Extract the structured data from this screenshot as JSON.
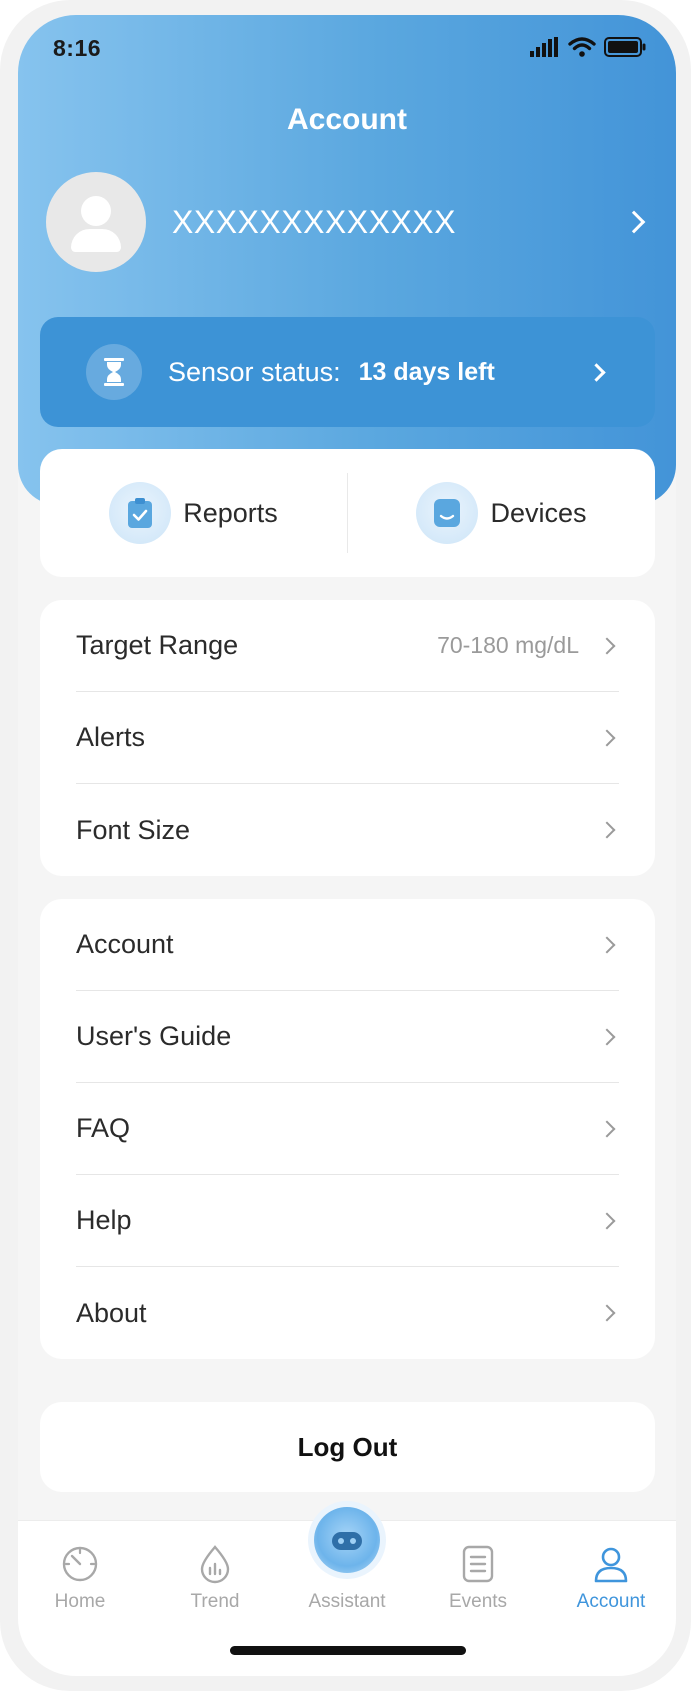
{
  "status_bar": {
    "time": "8:16"
  },
  "header": {
    "title": "Account"
  },
  "profile": {
    "name": "XXXXXXXXXXXXX"
  },
  "sensor": {
    "label": "Sensor status:",
    "value": "13 days left"
  },
  "quick_actions": [
    {
      "label": "Reports",
      "icon": "clipboard-check-icon"
    },
    {
      "label": "Devices",
      "icon": "sensor-device-icon"
    }
  ],
  "settings_menu": [
    {
      "label": "Target Range",
      "value": "70-180 mg/dL"
    },
    {
      "label": "Alerts",
      "value": ""
    },
    {
      "label": "Font Size",
      "value": ""
    }
  ],
  "info_menu": [
    {
      "label": "Account"
    },
    {
      "label": "User's Guide"
    },
    {
      "label": "FAQ"
    },
    {
      "label": "Help"
    },
    {
      "label": "About"
    }
  ],
  "logout": {
    "label": "Log Out"
  },
  "tabs": [
    {
      "label": "Home",
      "icon": "gauge-icon",
      "active": false
    },
    {
      "label": "Trend",
      "icon": "drop-chart-icon",
      "active": false
    },
    {
      "label": "Assistant",
      "icon": "assistant-bot-icon",
      "active": false
    },
    {
      "label": "Events",
      "icon": "list-icon",
      "active": false
    },
    {
      "label": "Account",
      "icon": "user-icon",
      "active": true
    }
  ],
  "colors": {
    "accent": "#3f95dc",
    "header_start": "#86c3ee",
    "header_end": "#4394d8",
    "sensor_bar": "#3d93d6"
  }
}
